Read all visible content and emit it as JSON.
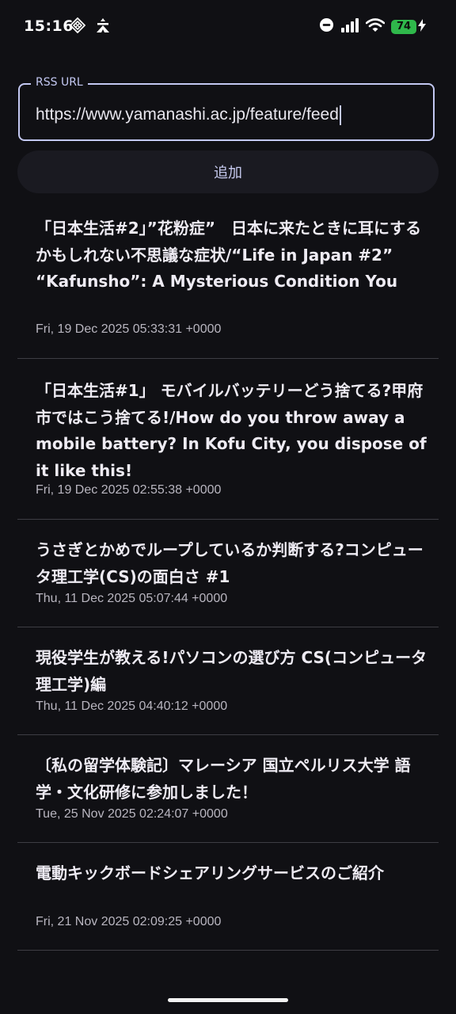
{
  "status_bar": {
    "time": "15:16",
    "battery_level": "74",
    "left_icons": [
      "diamond-app-icon",
      "navigation-tent-icon"
    ],
    "right_icons": [
      "do-not-disturb-icon",
      "cell-signal-icon",
      "wifi-icon",
      "battery-icon",
      "charging-bolt-icon"
    ]
  },
  "rss_input": {
    "label": "RSS URL",
    "value": "https://www.yamanashi.ac.jp/feature/feed"
  },
  "add_button": {
    "label": "追加"
  },
  "feed_items": [
    {
      "title": "「日本生活#2」”花粉症”　日本に来たときに耳にするかもしれない不思議な症状/“Life in Japan #2” “Kafunsho”: A Mysterious Condition You",
      "date": "Fri, 19 Dec 2025 05:33:31 +0000"
    },
    {
      "title": "「日本生活#1」 モバイルバッテリーどう捨てる?甲府市ではこう捨てる!/How do you throw away a mobile battery? In Kofu City, you dispose of it like this!",
      "date": "Fri, 19 Dec 2025 02:55:38 +0000"
    },
    {
      "title": "うさぎとかめでループしているか判断する?コンピュータ理工学(CS)の面白さ #1",
      "date": "Thu, 11 Dec 2025 05:07:44 +0000"
    },
    {
      "title": "現役学生が教える!パソコンの選び方 CS(コンピュータ理工学)編",
      "date": "Thu, 11 Dec 2025 04:40:12 +0000"
    },
    {
      "title": "〔私の留学体験記〕マレーシア 国立ペルリス大学 語学・文化研修に参加しました！",
      "date": "Tue, 25 Nov 2025 02:24:07 +0000"
    },
    {
      "title": "電動キックボードシェアリングサービスのご紹介",
      "date": "Fri, 21 Nov 2025 02:09:25 +0000"
    }
  ]
}
